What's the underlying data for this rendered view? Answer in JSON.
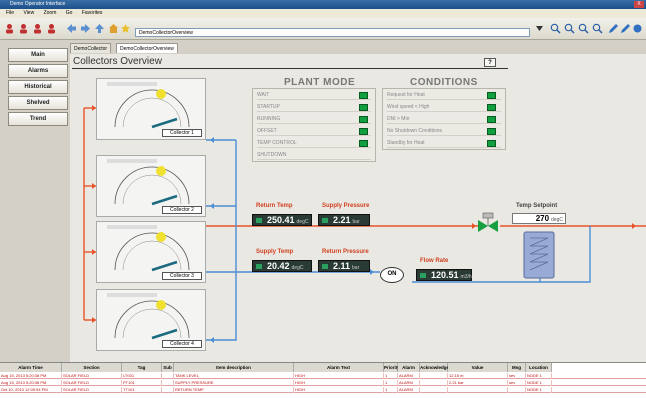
{
  "window": {
    "title": "Demo Operator Interface",
    "close": "X"
  },
  "menu": [
    "File",
    "View",
    "Zoom",
    "Go",
    "Favorites"
  ],
  "address": {
    "value": "DemoCollectorOverview"
  },
  "nav": {
    "items": [
      "Main",
      "Alarms",
      "Historical",
      "Shelved",
      "Trend"
    ]
  },
  "tabs": [
    {
      "label": "DemoCollector"
    },
    {
      "label": "DemoCollectorOverview"
    }
  ],
  "page": {
    "title": "Collectors Overview",
    "help": "?"
  },
  "collectors": [
    {
      "label": "Collector 1"
    },
    {
      "label": "Collector 2"
    },
    {
      "label": "Collector 3"
    },
    {
      "label": "Collector 4"
    }
  ],
  "plant_mode": {
    "title": "PLANT MODE",
    "rows": [
      "WAIT",
      "STARTUP",
      "RUNNING",
      "OFFSET",
      "TEMP CONTROL",
      "SHUTDOWN"
    ]
  },
  "conditions": {
    "title": "CONDITIONS",
    "rows": [
      "Request for Heat",
      "Wind speed < High",
      "DNI > Min",
      "No Shutdown Conditions",
      "Standby for Heat"
    ]
  },
  "measurements": {
    "return_temp": {
      "label": "Return Temp",
      "value": "250.41",
      "unit": "degC"
    },
    "supply_pressure": {
      "label": "Supply Pressure",
      "value": "2.21",
      "unit": "bar"
    },
    "supply_temp": {
      "label": "Supply Temp",
      "value": "20.42",
      "unit": "degC"
    },
    "return_pressure": {
      "label": "Return Pressure",
      "value": "2.11",
      "unit": "bar"
    },
    "flow_rate": {
      "label": "Flow Rate",
      "value": "120.51",
      "unit": "m3/h"
    },
    "temp_setpoint": {
      "label": "Temp Setpoint",
      "value": "270",
      "unit": "degC"
    }
  },
  "pump": {
    "label": "ON"
  },
  "alarm_table": {
    "headers": [
      "Alarm Time",
      "Section",
      "Tag",
      "Sub",
      "Item description",
      "Alarm Text",
      "Priority",
      "Alarm Type",
      "Acknowledged",
      "Value",
      "Msg class",
      "Location"
    ],
    "rows": [
      [
        "Aug 15, 2013 5:20:38 PM",
        "SOLAR FIELD",
        "LT001",
        "",
        "TANK LEVEL",
        "HIGH",
        "1",
        "ALARM",
        "",
        "12.15 m",
        "sev",
        "NODE 1"
      ],
      [
        "Aug 15, 2013 5:20:38 PM",
        "SOLAR FIELD",
        "PT101",
        "",
        "SUPPLY PRESSURE",
        "HIGH",
        "1",
        "ALARM",
        "",
        "2.21 bar",
        "sev",
        "NODE 1"
      ],
      [
        "Oct 10, 2013 12:09:54 PM",
        "SOLAR FIELD",
        "TT101",
        "",
        "RETURN TEMP",
        "HIGH",
        "1",
        "ALARM",
        "",
        "",
        "",
        "NODE 1"
      ]
    ]
  },
  "colors": {
    "hot_pipe": "#e8542a",
    "cold_pipe": "#4a8ed6",
    "led_on": "#10a040"
  }
}
